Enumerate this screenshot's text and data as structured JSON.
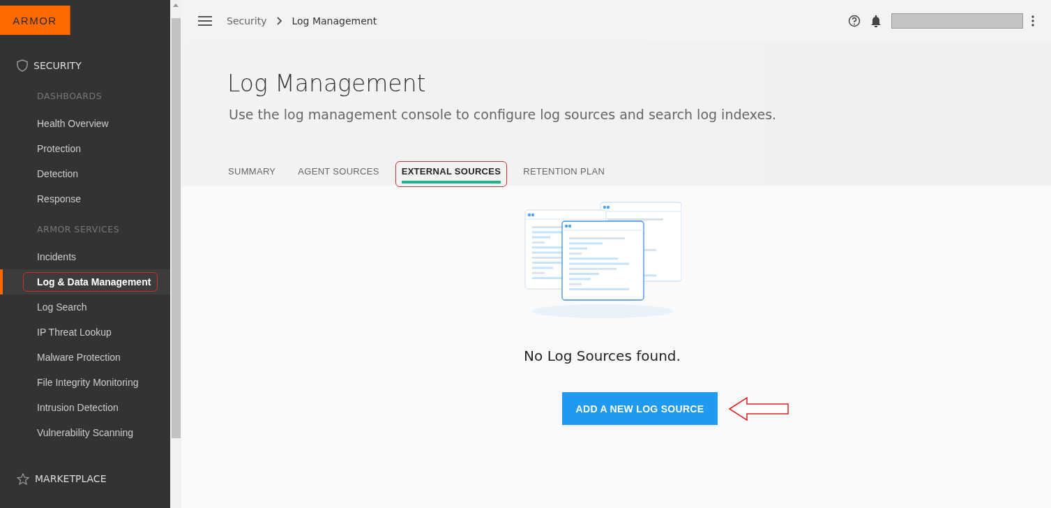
{
  "logo": {
    "text": "ARMOR"
  },
  "sidebar": {
    "sections": [
      {
        "kind": "heading",
        "label": "SECURITY"
      },
      {
        "kind": "group",
        "label": "DASHBOARDS",
        "items": [
          {
            "label": "Health Overview",
            "selected": false,
            "highlighted": false
          },
          {
            "label": "Protection",
            "selected": false,
            "highlighted": false
          },
          {
            "label": "Detection",
            "selected": false,
            "highlighted": false
          },
          {
            "label": "Response",
            "selected": false,
            "highlighted": false
          }
        ]
      },
      {
        "kind": "group",
        "label": "ARMOR SERVICES",
        "items": [
          {
            "label": "Incidents",
            "selected": false,
            "highlighted": false
          },
          {
            "label": "Log & Data Management",
            "selected": true,
            "highlighted": true
          },
          {
            "label": "Log Search",
            "selected": false,
            "highlighted": false
          },
          {
            "label": "IP Threat Lookup",
            "selected": false,
            "highlighted": false
          },
          {
            "label": "Malware Protection",
            "selected": false,
            "highlighted": false
          },
          {
            "label": "File Integrity Monitoring",
            "selected": false,
            "highlighted": false
          },
          {
            "label": "Intrusion Detection",
            "selected": false,
            "highlighted": false
          },
          {
            "label": "Vulnerability Scanning",
            "selected": false,
            "highlighted": false
          }
        ]
      },
      {
        "kind": "heading",
        "label": "MARKETPLACE"
      }
    ]
  },
  "breadcrumb": [
    "Security",
    "Log Management"
  ],
  "page": {
    "title": "Log Management",
    "subtitle": "Use the log management console to configure log sources and search log indexes."
  },
  "tabs": [
    {
      "label": "SUMMARY",
      "selected": false,
      "highlighted": false
    },
    {
      "label": "AGENT SOURCES",
      "selected": false,
      "highlighted": false
    },
    {
      "label": "EXTERNAL SOURCES",
      "selected": true,
      "highlighted": true
    },
    {
      "label": "RETENTION PLAN",
      "selected": false,
      "highlighted": false
    }
  ],
  "empty_state": {
    "message": "No Log Sources found.",
    "button": "ADD A NEW LOG SOURCE",
    "callout_arrow": true
  }
}
